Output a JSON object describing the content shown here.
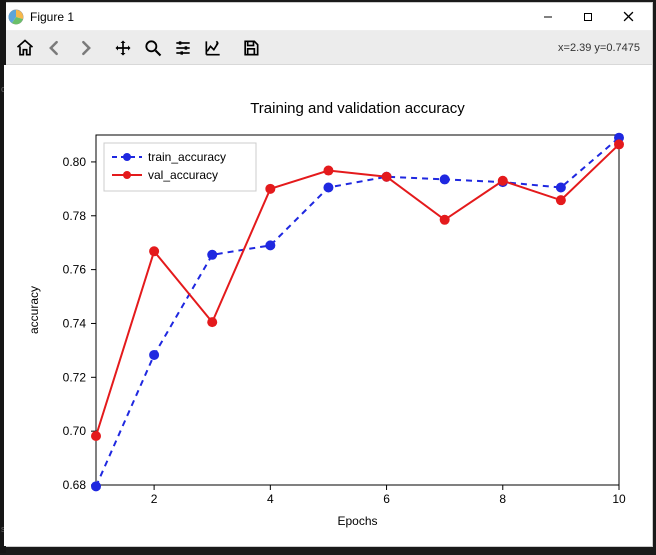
{
  "window": {
    "title": "Figure 1"
  },
  "toolbar": {
    "coord_readout": "x=2.39 y=0.7475"
  },
  "chart_data": {
    "type": "line",
    "title": "Training and validation accuracy",
    "xlabel": "Epochs",
    "ylabel": "accuracy",
    "xlim": [
      1,
      10
    ],
    "ylim": [
      0.68,
      0.81
    ],
    "xticks": [
      2,
      4,
      6,
      8,
      10
    ],
    "yticks": [
      0.68,
      0.7,
      0.72,
      0.74,
      0.76,
      0.78,
      0.8
    ],
    "x": [
      1,
      2,
      3,
      4,
      5,
      6,
      7,
      8,
      9,
      10
    ],
    "series": [
      {
        "name": "train_accuracy",
        "style": "dashed",
        "color": "#1f28e0",
        "values": [
          0.6795,
          0.7283,
          0.7655,
          0.769,
          0.7905,
          0.7945,
          0.7935,
          0.7925,
          0.7905,
          0.809
        ]
      },
      {
        "name": "val_accuracy",
        "style": "solid",
        "color": "#e41a1c",
        "values": [
          0.6982,
          0.7668,
          0.7405,
          0.79,
          0.7968,
          0.7945,
          0.7785,
          0.793,
          0.7858,
          0.8065
        ]
      }
    ],
    "legend_location": "upper-left"
  }
}
